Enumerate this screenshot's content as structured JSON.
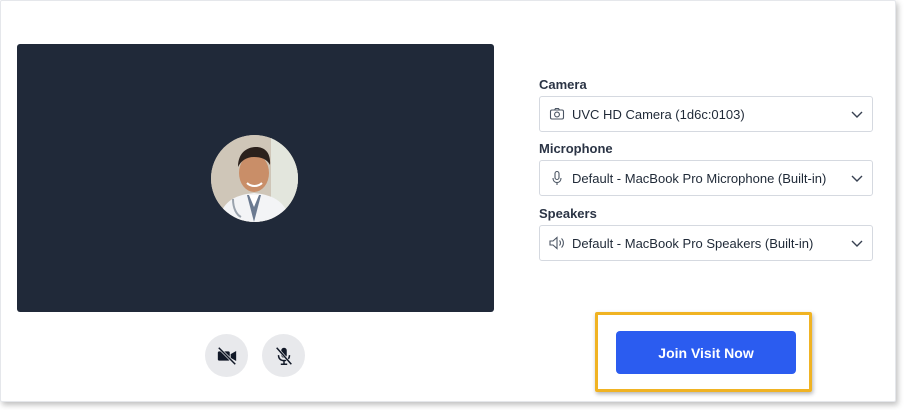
{
  "preview": {
    "avatar_alt": "doctor-avatar"
  },
  "controls": {
    "camera_icon": "video-off-icon",
    "mic_icon": "mic-off-icon"
  },
  "devices": {
    "camera": {
      "label": "Camera",
      "value": "UVC HD Camera (1d6c:0103)",
      "icon": "camera-icon"
    },
    "microphone": {
      "label": "Microphone",
      "value": "Default - MacBook Pro Microphone (Built-in)",
      "icon": "microphone-icon"
    },
    "speakers": {
      "label": "Speakers",
      "value": "Default - MacBook Pro Speakers (Built-in)",
      "icon": "speaker-icon"
    }
  },
  "actions": {
    "join_label": "Join Visit Now"
  },
  "colors": {
    "video_bg": "#202939",
    "primary": "#2b5cf0",
    "highlight": "#f0b323"
  }
}
